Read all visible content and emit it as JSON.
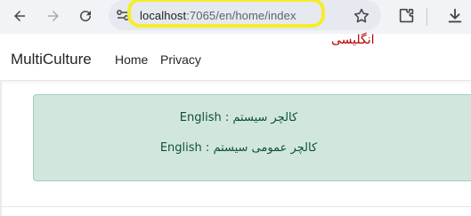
{
  "browser": {
    "url_host": "localhost",
    "url_rest": ":7065/en/home/index",
    "annotation": "انگلیسی"
  },
  "navbar": {
    "brand": "MultiCulture",
    "links": [
      "Home",
      "Privacy"
    ]
  },
  "alert": {
    "lines": [
      "English : کالچر سیستم",
      "English : کالچر عمومی سیستم"
    ]
  },
  "colors": {
    "highlight": "#f6ec2a",
    "alert_bg": "#d1e7dd",
    "annotation": "#b40000"
  }
}
